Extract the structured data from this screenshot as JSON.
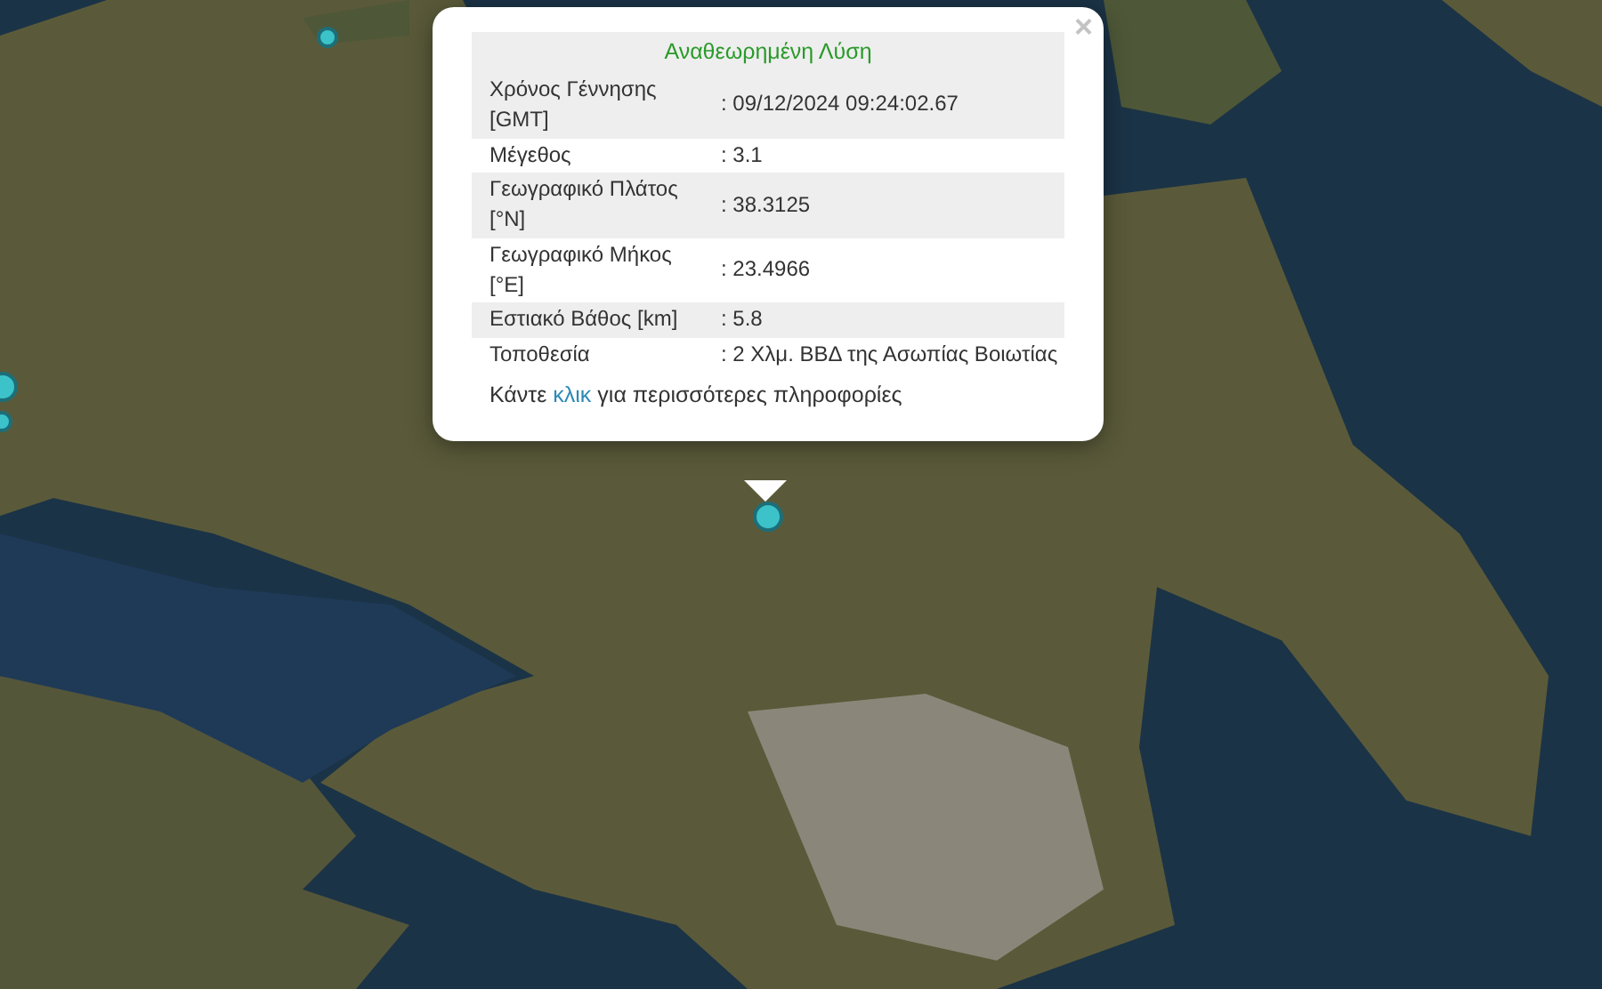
{
  "popup": {
    "title": "Αναθεωρημένη Λύση",
    "close": "×",
    "rows": [
      {
        "label": "Χρόνος Γέννησης [GMT]",
        "value": ": 09/12/2024 09:24:02.67"
      },
      {
        "label": "Μέγεθος",
        "value": ": 3.1"
      },
      {
        "label": "Γεωγραφικό Πλάτος [°N]",
        "value": ": 38.3125"
      },
      {
        "label": "Γεωγραφικό Μήκος [°E]",
        "value": ": 23.4966"
      },
      {
        "label": "Εστιακό Βάθος [km]",
        "value": ": 5.8"
      },
      {
        "label": "Τοποθεσία",
        "value": ": 2 Χλμ. ΒΒΔ της Ασωπίας Βοιωτίας"
      }
    ],
    "footer": {
      "before": "Κάντε ",
      "link": "κλικ",
      "after": " για περισσότερες πληροφορίες"
    }
  }
}
